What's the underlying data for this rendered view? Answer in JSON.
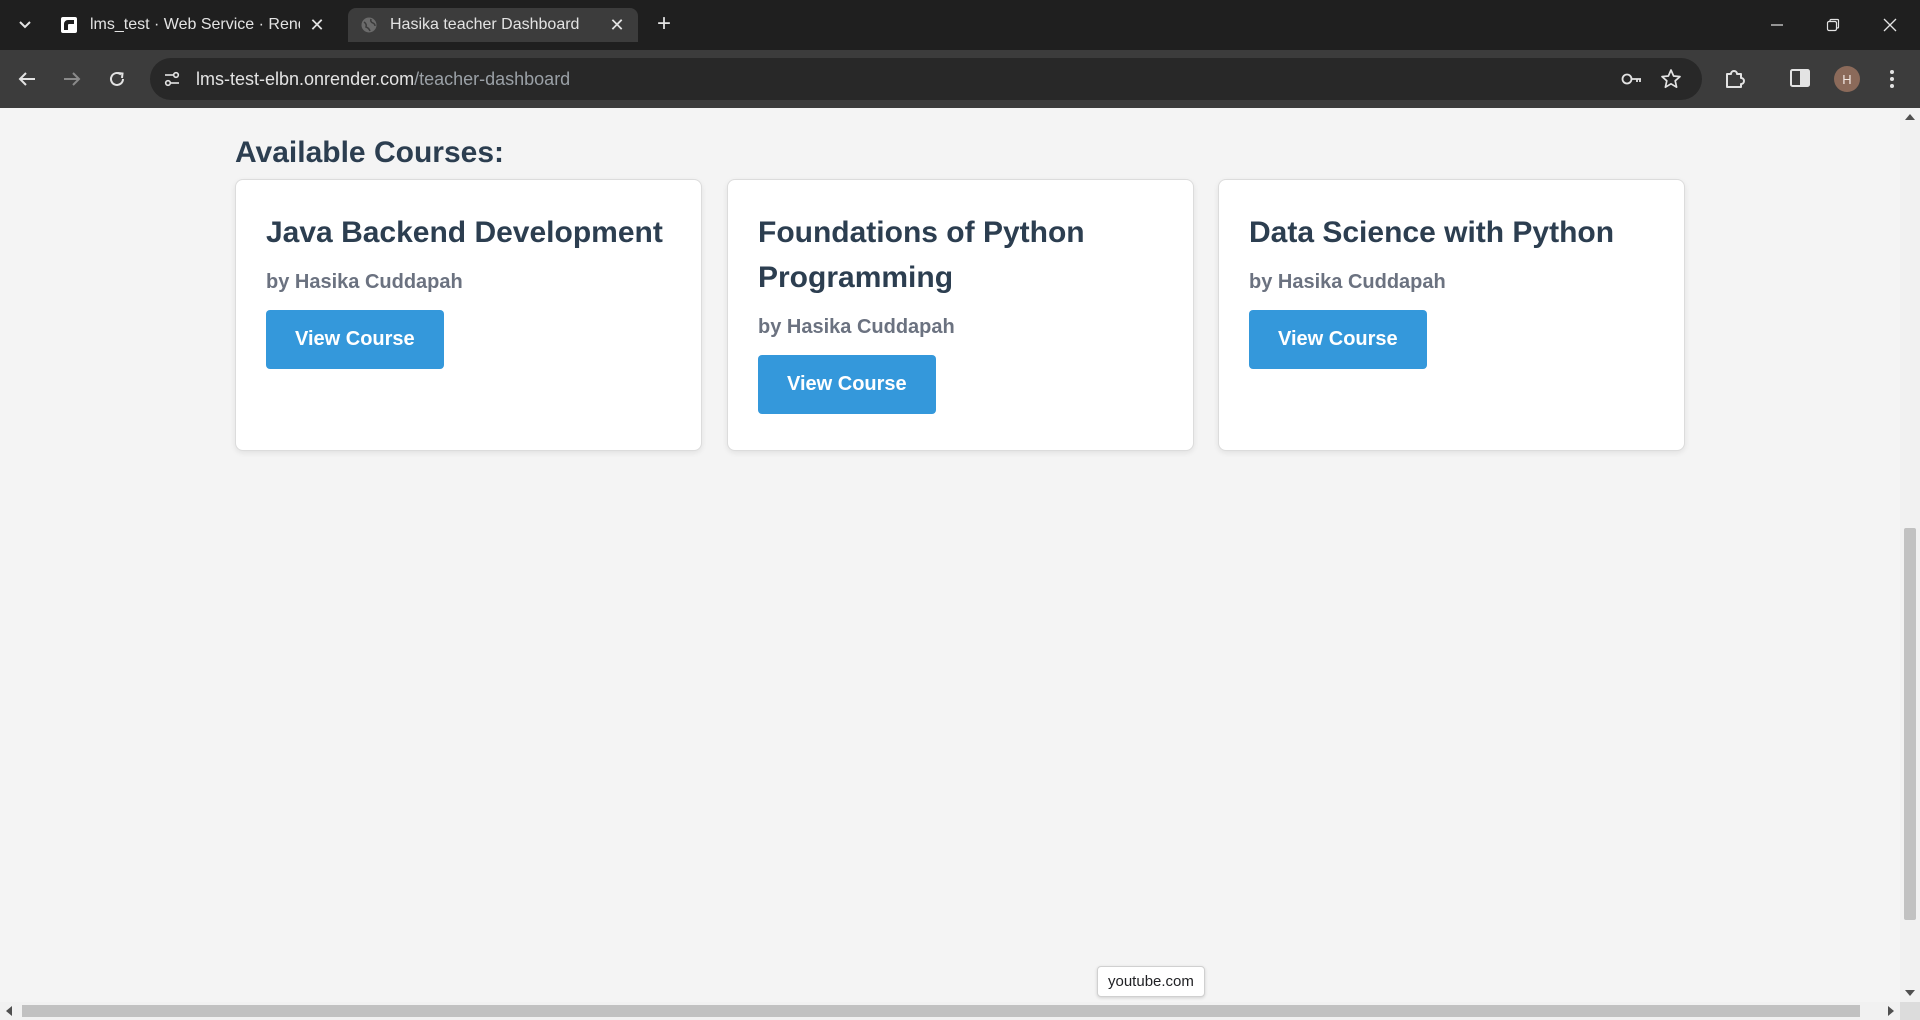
{
  "browser": {
    "tabs": [
      {
        "title": "lms_test · Web Service · Render",
        "active": false
      },
      {
        "title": "Hasika teacher Dashboard",
        "active": true
      }
    ],
    "url_host": "lms-test-elbn.onrender.com",
    "url_path": "/teacher-dashboard",
    "profile_initial": "H"
  },
  "page": {
    "section_title": "Available Courses:",
    "courses": [
      {
        "title": "Java Backend Development",
        "author": "by Hasika Cuddapah",
        "button": "View Course"
      },
      {
        "title": "Foundations of Python Programming",
        "author": "by Hasika Cuddapah",
        "button": "View Course"
      },
      {
        "title": "Data Science with Python",
        "author": "by Hasika Cuddapah",
        "button": "View Course"
      }
    ]
  },
  "status_tooltip": "youtube.com",
  "colors": {
    "primary_button": "#3498db",
    "heading": "#2c3e50",
    "author_text": "#6b7280",
    "page_bg": "#f4f4f4"
  },
  "icons": {
    "tab_menu": "chevron-down-icon",
    "render_favicon": "render-logo-icon",
    "globe_favicon": "globe-icon",
    "key": "key-icon",
    "star": "star-icon",
    "extensions": "puzzle-icon",
    "side_panel": "side-panel-icon",
    "more": "more-vertical-icon"
  }
}
